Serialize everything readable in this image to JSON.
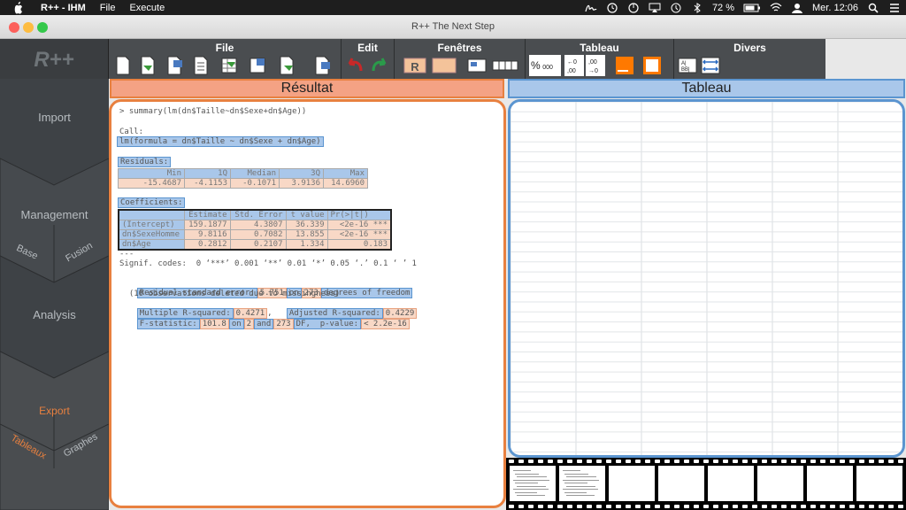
{
  "menubar": {
    "app_name": "R++ - IHM",
    "menus": [
      "File",
      "Execute"
    ],
    "battery": "72 %",
    "clock": "Mer. 12:06"
  },
  "window": {
    "title": "R++   The Next Step",
    "traffic_colors": [
      "#fc605b",
      "#fdbc40",
      "#34c84a"
    ]
  },
  "logo": {
    "text": "R++"
  },
  "nav": {
    "import": "Import",
    "management": "Management",
    "management_sub": [
      "Base",
      "Fusion"
    ],
    "analysis": "Analysis",
    "export": "Export",
    "export_sub": [
      "Tableaux",
      "Graphes"
    ],
    "active_color": "#e8803f"
  },
  "toolbar": {
    "groups": [
      "File",
      "Edit",
      "Fenêtres",
      "Tableau",
      "Divers"
    ],
    "tableau_icons": [
      "%",
      "000"
    ]
  },
  "panels": {
    "result_title": "Résultat",
    "tableau_title": "Tableau"
  },
  "result": {
    "command": "> summary(lm(dn$Taille~dn$Sexe+dn$Age))",
    "call_label": "Call:",
    "call": "lm(formula = dn$Taille ~ dn$Sexe + dn$Age)",
    "residuals_label": "Residuals:",
    "residuals_headers": [
      "Min",
      "1Q",
      "Median",
      "3Q",
      "Max"
    ],
    "residuals_values": [
      "-15.4687",
      "-4.1153",
      "-0.1071",
      "3.9136",
      "14.6960"
    ],
    "coef_label": "Coefficients:",
    "coef_headers": [
      "",
      "Estimate",
      "Std. Error",
      "t value",
      "Pr(>|t|)"
    ],
    "coef_rows": [
      [
        "(Intercept)",
        "159.1877",
        "4.3807",
        "36.339",
        "<2e-16 ***"
      ],
      [
        "dn$SexeHomme",
        "9.8116",
        "0.7082",
        "13.855",
        "<2e-16 ***"
      ],
      [
        "dn$Age",
        "0.2812",
        "0.2107",
        "1.334",
        "0.183"
      ]
    ],
    "dashes": "---",
    "signif": "Signif. codes:  0 ‘***’ 0.001 ‘**’ 0.01 ‘*’ 0.05 ‘.’ 0.1 ‘ ’ 1",
    "rse_label": "Residual standard error:",
    "rse_value": "5.751",
    "rse_on": "on",
    "rse_df": "273",
    "rse_tail": "degrees of freedom",
    "missing": "  (10 observations deleted due to missingness)",
    "mr2_label": "Multiple R-squared:",
    "mr2_value": "0.4271",
    "comma": ",",
    "ar2_label": "Adjusted R-squared:",
    "ar2_value": "0.4229",
    "f_label": "F-statistic:",
    "f_value": "101.8",
    "f_on": "on",
    "f_df1": "2",
    "f_and": "and",
    "f_df2": "273",
    "f_df": "DF,  p-value:",
    "p_value": "< 2.2e-16"
  }
}
